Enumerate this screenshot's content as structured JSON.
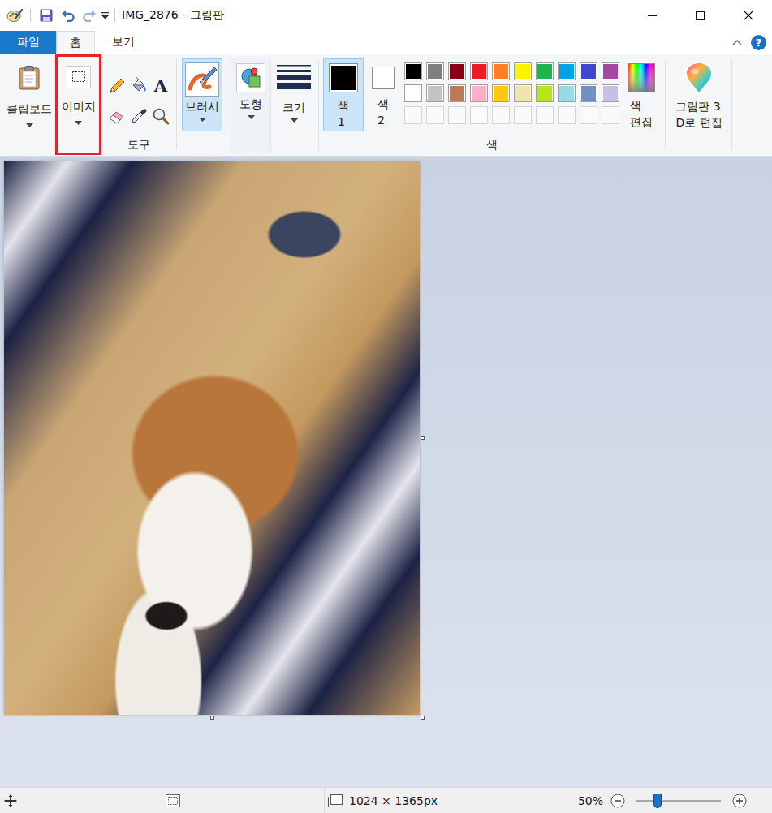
{
  "window": {
    "title": "IMG_2876 - 그림판"
  },
  "file_menu": {
    "label": "파일"
  },
  "tabs": [
    {
      "label": "홈",
      "selected": true
    },
    {
      "label": "보기",
      "selected": false
    }
  ],
  "help": "?",
  "ribbon": {
    "clipboard": {
      "label": "클립보드"
    },
    "image": {
      "label": "이미지",
      "highlighted": true
    },
    "tools": {
      "label": "도구",
      "items": [
        {
          "kind": "pencil"
        },
        {
          "kind": "fill"
        },
        {
          "kind": "text",
          "glyph": "A"
        },
        {
          "kind": "eraser"
        },
        {
          "kind": "picker"
        },
        {
          "kind": "magnifier"
        }
      ]
    },
    "brush": {
      "label": "브러시",
      "selected": true
    },
    "shapes": {
      "label": "도형"
    },
    "size": {
      "label": "크기"
    },
    "color1": {
      "label": "색\n1",
      "selected": true,
      "color": "#000000"
    },
    "color2": {
      "label": "색\n2",
      "selected": false,
      "color": "#ffffff"
    },
    "palette": {
      "label": "색",
      "colors": [
        "#000000",
        "#7f7f7f",
        "#880015",
        "#ed1c24",
        "#ff7f27",
        "#fff200",
        "#22b14c",
        "#00a2e8",
        "#3f48cc",
        "#a349a4",
        "#ffffff",
        "#c3c3c3",
        "#b97a57",
        "#ffaec9",
        "#ffc90e",
        "#efe4b0",
        "#b5e61d",
        "#99d9ea",
        "#7092be",
        "#c8bfe7"
      ],
      "custom": [
        null,
        null,
        null,
        null,
        null,
        null,
        null,
        null,
        null,
        null
      ]
    },
    "edit_colors": {
      "label": "색\n편집"
    },
    "paint3d": {
      "label": "그림판 3\nD로 편집"
    }
  },
  "status_bar": {
    "dimensions": "1024 × 1365px",
    "zoom": "50%",
    "zoom_level": 0.26
  }
}
